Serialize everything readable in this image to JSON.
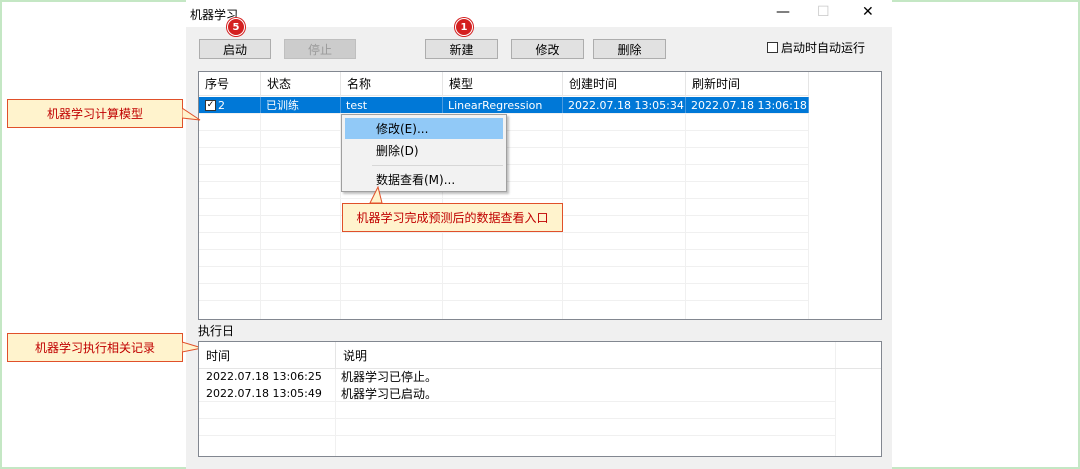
{
  "window": {
    "title": "机器学习",
    "minimize": "—",
    "maximize": "☐",
    "close": "✕"
  },
  "toolbar": {
    "start": "启动",
    "stop": "停止",
    "new": "新建",
    "edit": "修改",
    "delete": "删除",
    "autorun": "启动时自动运行"
  },
  "badges": {
    "start": "5",
    "new": "1"
  },
  "table": {
    "columns": [
      "序号",
      "状态",
      "名称",
      "模型",
      "创建时间",
      "刷新时间"
    ],
    "rows": [
      {
        "checked": true,
        "index": "2",
        "status": "已训练",
        "name": "test",
        "model": "LinearRegression",
        "created": "2022.07.18 13:05:34",
        "refreshed": "2022.07.18 13:06:18"
      }
    ]
  },
  "context_menu": {
    "items": [
      "修改(E)...",
      "删除(D)",
      "数据查看(M)..."
    ]
  },
  "callouts": {
    "model": "机器学习计算模型",
    "view": "机器学习完成预测后的数据查看入口",
    "log": "机器学习执行相关记录"
  },
  "log": {
    "title": "执行日",
    "columns": [
      "时间",
      "说明"
    ],
    "rows": [
      {
        "time": "2022.07.18 13:06:25",
        "desc": "机器学习已停止。"
      },
      {
        "time": "2022.07.18 13:05:49",
        "desc": "机器学习已启动。"
      }
    ]
  },
  "colors": {
    "selection": "#0078d7",
    "callout_bg": "#fff3cd",
    "callout_border": "#e0502a",
    "callout_text": "#c00000",
    "badge": "#d42020"
  }
}
